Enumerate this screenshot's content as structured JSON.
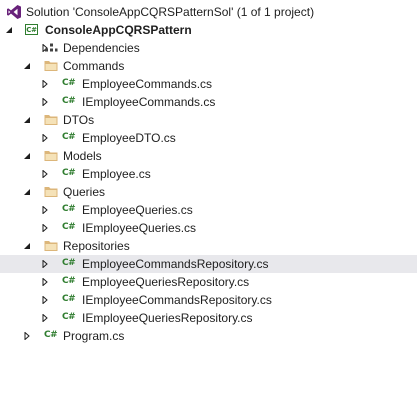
{
  "solution_explorer": {
    "solution_label": "Solution 'ConsoleAppCQRSPatternSol' (1 of 1 project)",
    "project_label": "ConsoleAppCQRSPattern",
    "dependencies_label": "Dependencies",
    "folders": {
      "commands": {
        "label": "Commands",
        "files": [
          "EmployeeCommands.cs",
          "IEmployeeCommands.cs"
        ]
      },
      "dtos": {
        "label": "DTOs",
        "files": [
          "EmployeeDTO.cs"
        ]
      },
      "models": {
        "label": "Models",
        "files": [
          "Employee.cs"
        ]
      },
      "queries": {
        "label": "Queries",
        "files": [
          "EmployeeQueries.cs",
          "IEmployeeQueries.cs"
        ]
      },
      "repositories": {
        "label": "Repositories",
        "files": [
          "EmployeeCommandsRepository.cs",
          "EmployeeQueriesRepository.cs",
          "IEmployeeCommandsRepository.cs",
          "IEmployeeQueriesRepository.cs"
        ]
      }
    },
    "program_label": "Program.cs",
    "selected_item": "EmployeeCommandsRepository.cs",
    "icons": {
      "solution": "visual-studio-solution-icon",
      "project": "csharp-project-icon",
      "dependencies": "dependencies-icon",
      "folder": "folder-icon",
      "cs_file": "csharp-file-icon",
      "badge_text": "C#"
    },
    "colors": {
      "selection_bg": "#e8e8ec",
      "folder": "#dcb67a",
      "csharp_green": "#2f7d2f",
      "vs_purple": "#68217a"
    }
  }
}
